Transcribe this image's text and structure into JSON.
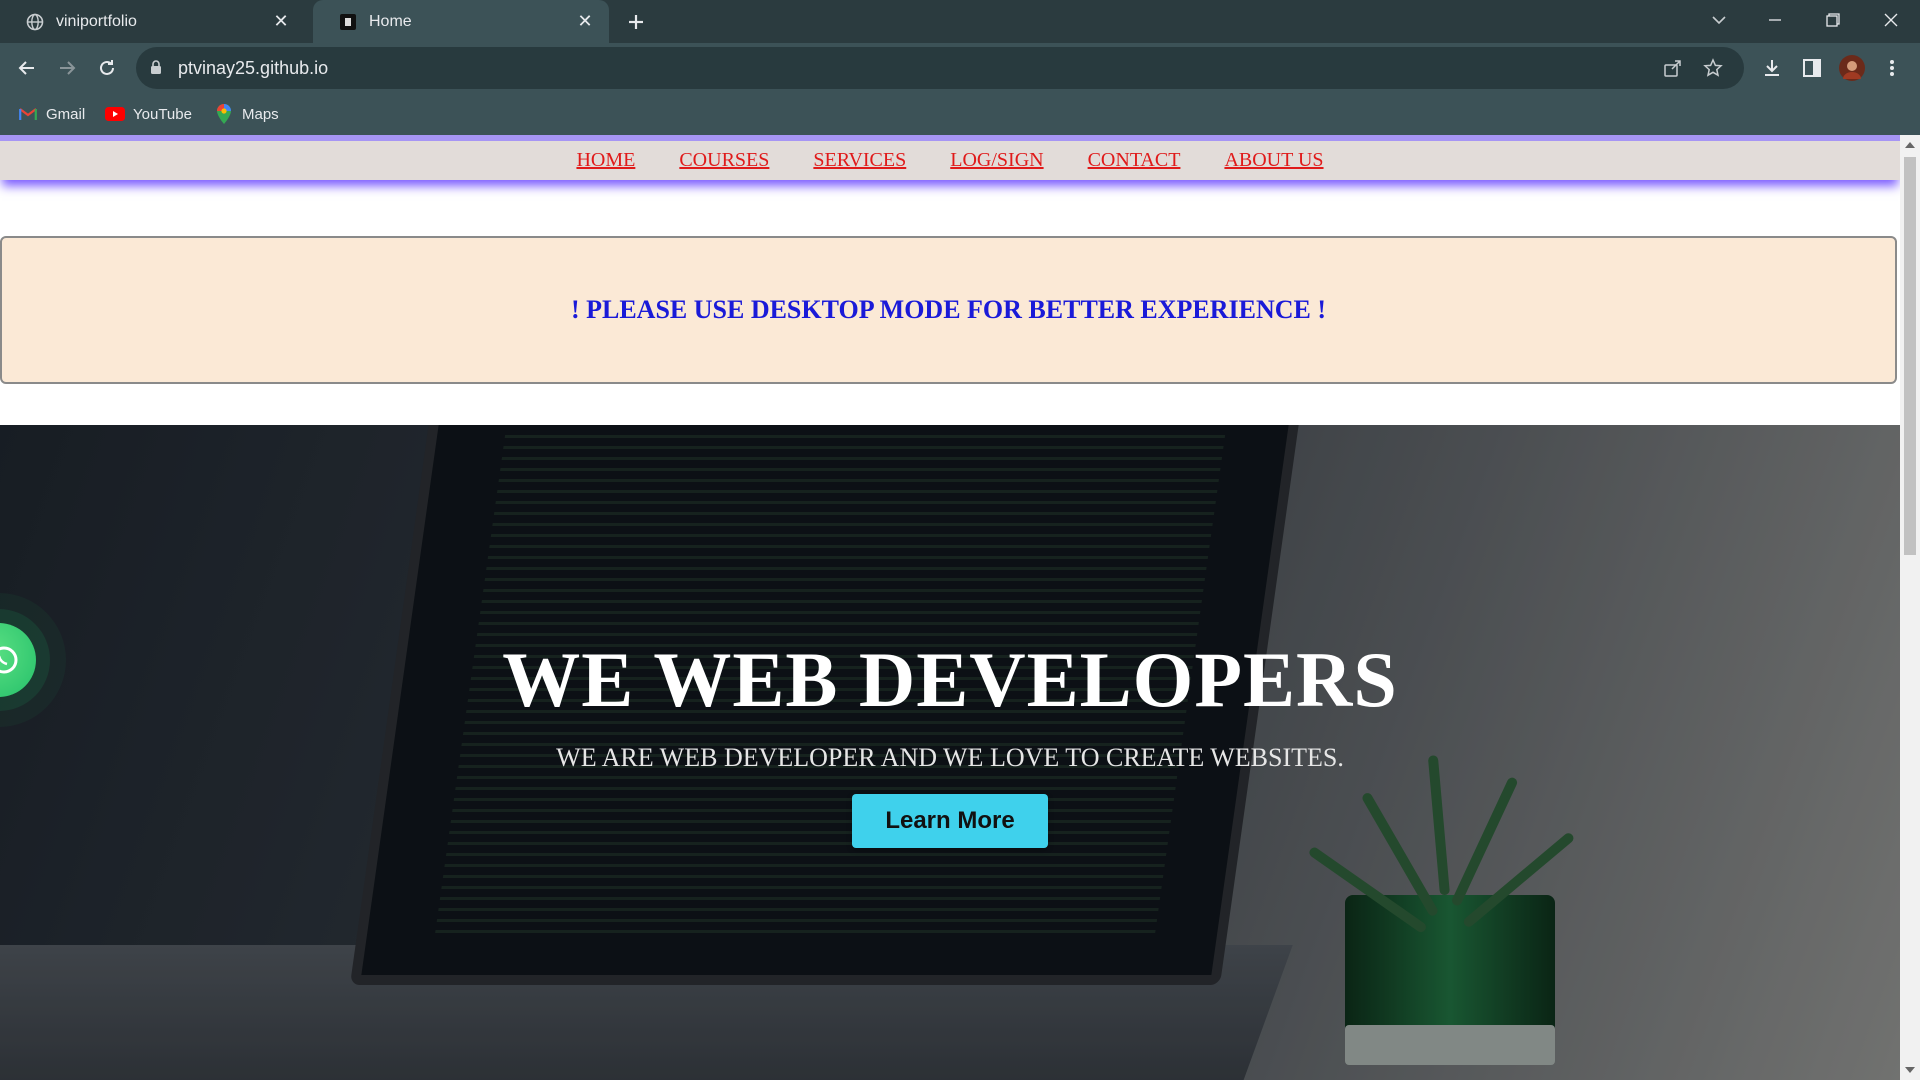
{
  "browser": {
    "tabs": [
      {
        "title": "viniportfolio",
        "icon": "globe-icon",
        "active": false
      },
      {
        "title": "Home",
        "icon": "site-favicon-icon",
        "active": true
      }
    ],
    "url": "ptvinay25.github.io",
    "bookmarks": [
      {
        "label": "Gmail",
        "icon": "gmail-icon"
      },
      {
        "label": "YouTube",
        "icon": "youtube-icon"
      },
      {
        "label": "Maps",
        "icon": "maps-icon"
      }
    ],
    "colors": {
      "tabstrip": "#2b3b3f",
      "toolbar": "#3c5257",
      "omnibox": "#283a3e"
    }
  },
  "page": {
    "nav": [
      "HOME",
      "COURSES",
      "SERVICES",
      "LOG/SIGN",
      "CONTACT",
      "ABOUT US"
    ],
    "notice": "! PLEASE USE DESKTOP MODE FOR BETTER EXPERIENCE !",
    "hero": {
      "title": "WE WEB DEVELOPERS",
      "subtitle": "WE ARE WEB DEVELOPER AND WE LOVE TO CREATE WEBSITES.",
      "button": "Learn More"
    },
    "colors": {
      "nav_link": "#e01a1a",
      "notice_text": "#1a1ad8",
      "notice_bg": "#fbe9d6",
      "button": "#3fd1ec",
      "nav_border": "#a695f4"
    }
  }
}
